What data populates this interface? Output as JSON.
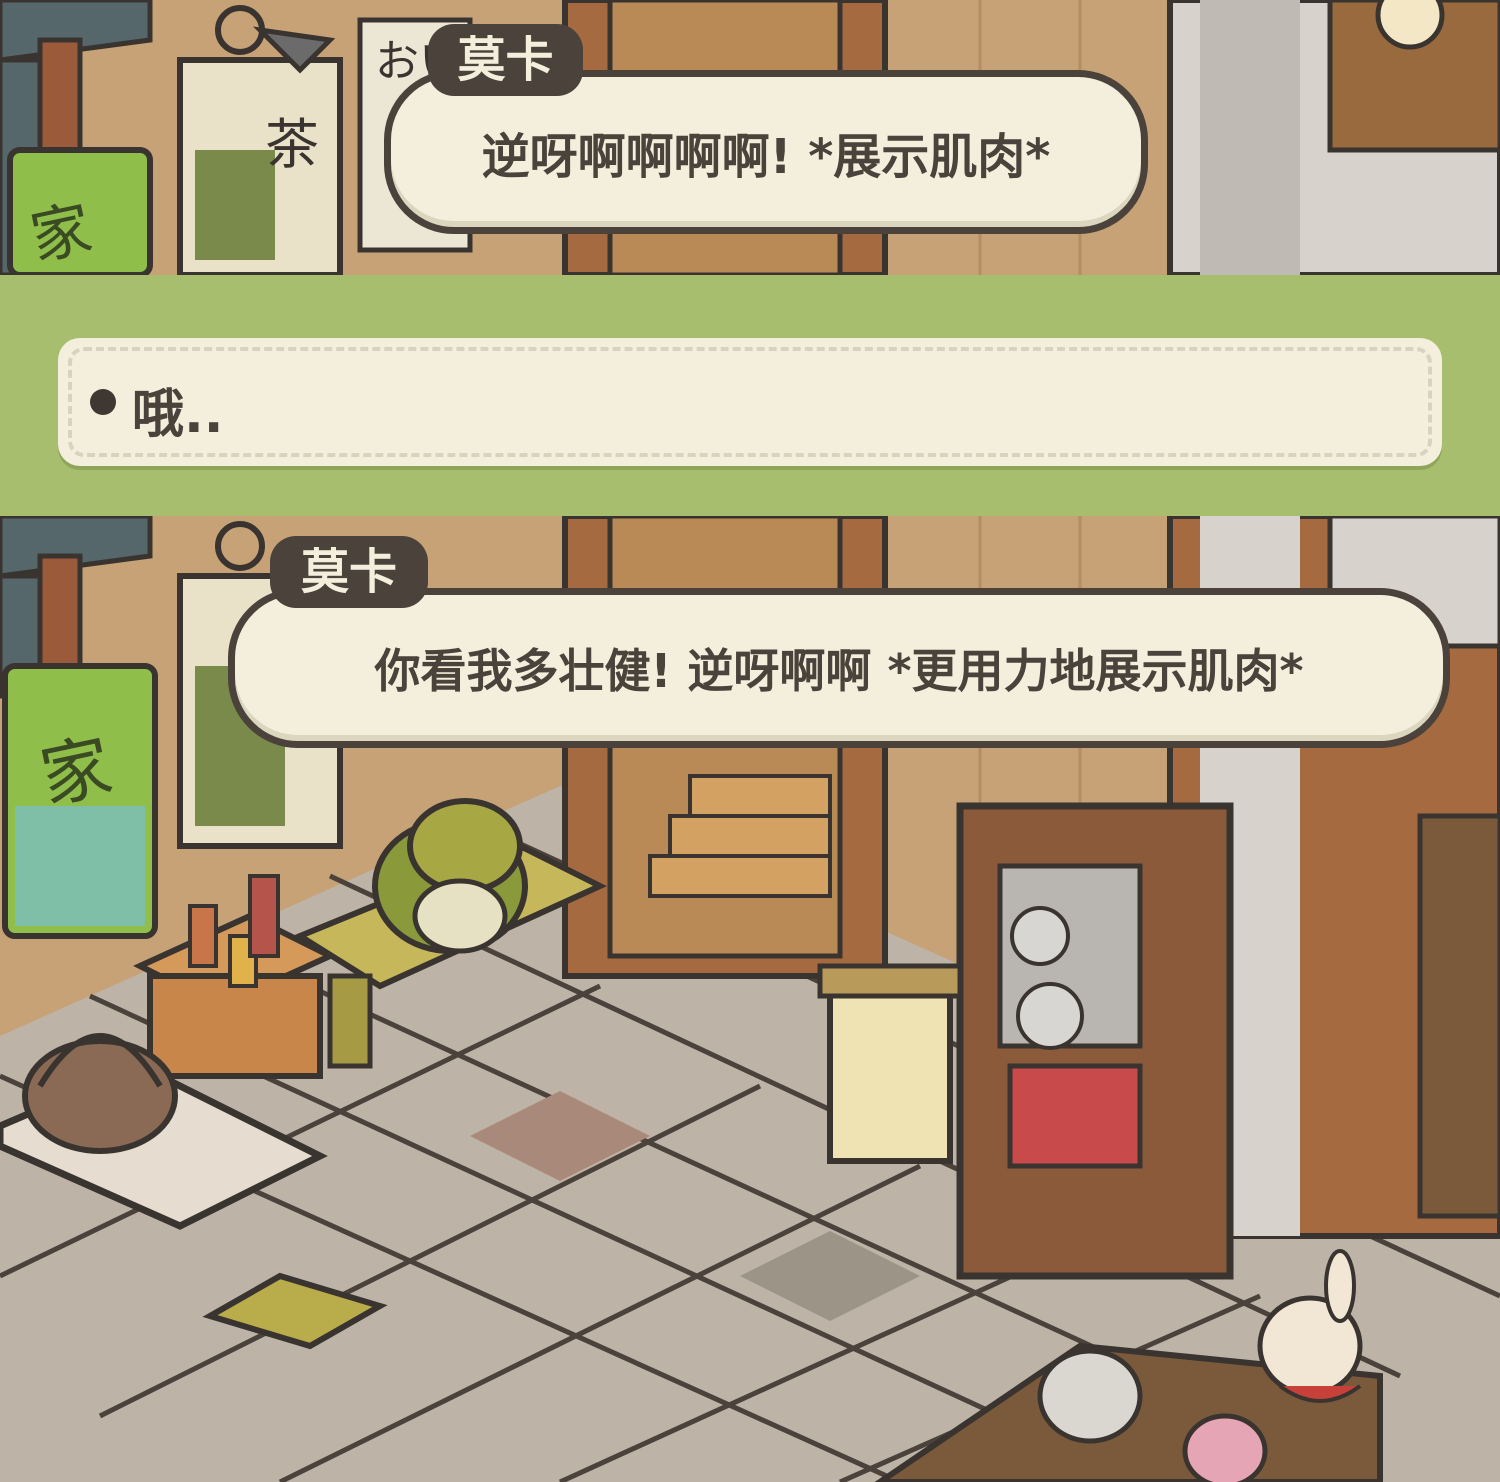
{
  "dialog_1": {
    "speaker": "莫卡",
    "text": "逆呀啊啊啊啊! *展示肌肉*"
  },
  "choice": {
    "text": "哦.."
  },
  "dialog_2": {
    "speaker": "莫卡",
    "text": "你看我多壮健! 逆呀啊啊 *更用力地展示肌肉*"
  },
  "scene": {
    "sign_left": "家",
    "sign_tea": "茶",
    "sign_partial": "おい"
  },
  "colors": {
    "bubble_fill": "#f3efdc",
    "outline": "#4a423b",
    "choice_bg": "#a7be6e",
    "wall": "#c9a57a"
  }
}
